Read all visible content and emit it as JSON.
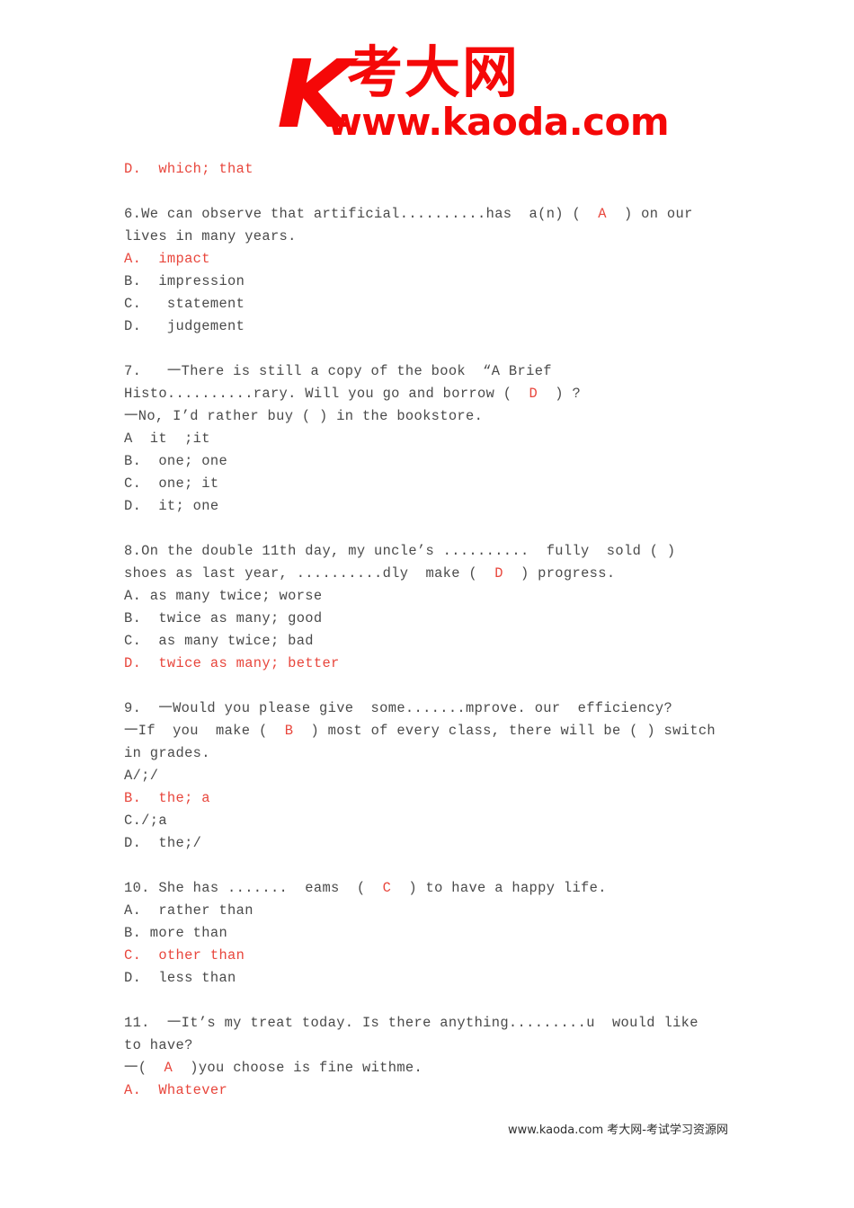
{
  "logo": {
    "mark": "K",
    "chinese": "考大网",
    "url": "www.kaoda.com"
  },
  "footer": {
    "text": "www.kaoda.com 考大网-考试学习资源网"
  },
  "document": {
    "blocks": [
      {
        "id": "q5-tail",
        "lines": [
          {
            "id": "q5-opt-d",
            "text": "D.  which; that",
            "color": "red"
          }
        ]
      },
      {
        "id": "q6",
        "lines": [
          {
            "id": "q6-stem-1",
            "text": "6.We can observe that artificial..........has  a(n) (  A  ) on our",
            "color": "gray",
            "answer": "A"
          },
          {
            "id": "q6-stem-2",
            "text": "lives in many years.",
            "color": "gray"
          },
          {
            "id": "q6-opt-a",
            "text": "A.  impact",
            "color": "red"
          },
          {
            "id": "q6-opt-b",
            "text": "B.  impression",
            "color": "gray"
          },
          {
            "id": "q6-opt-c",
            "text": "C.   statement",
            "color": "gray"
          },
          {
            "id": "q6-opt-d",
            "text": "D.   judgement",
            "color": "gray"
          }
        ]
      },
      {
        "id": "q7",
        "lines": [
          {
            "id": "q7-stem-1",
            "text": "7.   一There is still a copy of the book  “A Brief",
            "color": "gray"
          },
          {
            "id": "q7-stem-2",
            "text": "Histo..........rary. Will you go and borrow (  D  ) ?",
            "color": "gray",
            "answer": "D"
          },
          {
            "id": "q7-stem-3",
            "text": "一No, I’d rather buy ( ) in the bookstore.",
            "color": "gray"
          },
          {
            "id": "q7-opt-a",
            "text": "A  it  ;it",
            "color": "gray"
          },
          {
            "id": "q7-opt-b",
            "text": "B.  one; one",
            "color": "gray"
          },
          {
            "id": "q7-opt-c",
            "text": "C.  one; it",
            "color": "gray"
          },
          {
            "id": "q7-opt-d",
            "text": "D.  it; one",
            "color": "gray"
          }
        ]
      },
      {
        "id": "q8",
        "lines": [
          {
            "id": "q8-stem-1",
            "text": "8.On the double 11th day, my uncle’s ..........  fully  sold ( )",
            "color": "gray"
          },
          {
            "id": "q8-stem-2",
            "text": "shoes as last year, ..........dly  make (  D  ) progress.",
            "color": "gray",
            "answer": "D"
          },
          {
            "id": "q8-opt-a",
            "text": "A. as many twice; worse",
            "color": "gray"
          },
          {
            "id": "q8-opt-b",
            "text": "B.  twice as many; good",
            "color": "gray"
          },
          {
            "id": "q8-opt-c",
            "text": "C.  as many twice; bad",
            "color": "gray"
          },
          {
            "id": "q8-opt-d",
            "text": "D.  twice as many; better",
            "color": "red"
          }
        ]
      },
      {
        "id": "q9",
        "lines": [
          {
            "id": "q9-stem-1",
            "text": "9.  一Would you please give  some.......mprove. our  efficiency?",
            "color": "gray"
          },
          {
            "id": "q9-stem-2",
            "text": "一If  you  make (  B  ) most of every class, there will be ( ) switch",
            "color": "gray",
            "answer": "B"
          },
          {
            "id": "q9-stem-3",
            "text": "in grades.",
            "color": "gray"
          },
          {
            "id": "q9-opt-a",
            "text": "A/;/",
            "color": "gray"
          },
          {
            "id": "q9-opt-b",
            "text": "B.  the; a",
            "color": "red"
          },
          {
            "id": "q9-opt-c",
            "text": "C./;a",
            "color": "gray"
          },
          {
            "id": "q9-opt-d",
            "text": "D.  the;/",
            "color": "gray"
          }
        ]
      },
      {
        "id": "q10",
        "lines": [
          {
            "id": "q10-stem-1",
            "text": "10. She has .......  eams  (  C  ) to have a happy life.",
            "color": "gray",
            "answer": "C"
          },
          {
            "id": "q10-opt-a",
            "text": "A.  rather than",
            "color": "gray"
          },
          {
            "id": "q10-opt-b",
            "text": "B. more than",
            "color": "gray"
          },
          {
            "id": "q10-opt-c",
            "text": "C.  other than",
            "color": "red"
          },
          {
            "id": "q10-opt-d",
            "text": "D.  less than",
            "color": "gray"
          }
        ]
      },
      {
        "id": "q11",
        "lines": [
          {
            "id": "q11-stem-1",
            "text": "11.  一It’s my treat today. Is there anything.........u  would like",
            "color": "gray"
          },
          {
            "id": "q11-stem-2",
            "text": "to have?",
            "color": "gray"
          },
          {
            "id": "q11-stem-3",
            "text": "一(  A  )you choose is fine withme.",
            "color": "gray",
            "answer": "A"
          },
          {
            "id": "q11-opt-a",
            "text": "A.  Whatever",
            "color": "red"
          }
        ]
      }
    ]
  },
  "colors": {
    "answer_red": "#e8463c",
    "body_gray": "#4a4a4a",
    "logo_red": "#f50808"
  }
}
